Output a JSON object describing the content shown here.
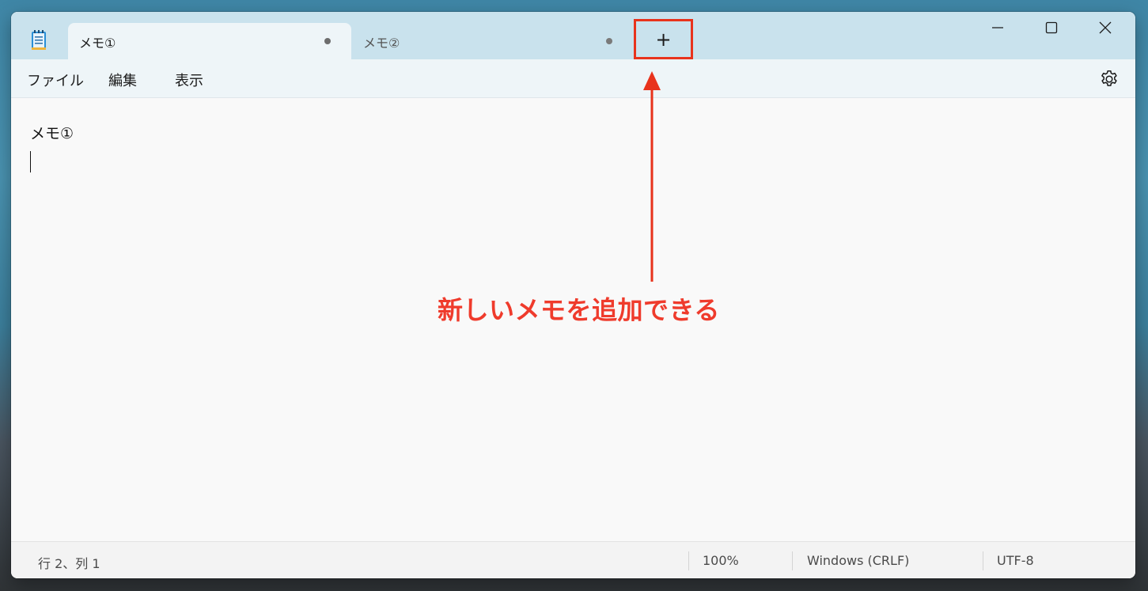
{
  "tabs": [
    {
      "label": "メモ①",
      "active": true
    },
    {
      "label": "メモ②",
      "active": false
    }
  ],
  "new_tab": {
    "label": "+"
  },
  "menu": {
    "items": [
      "ファイル",
      "編集",
      "表示"
    ]
  },
  "editor": {
    "lines": [
      "メモ①",
      ""
    ]
  },
  "annotation": {
    "text": "新しいメモを追加できる",
    "color": "#ef3b2c"
  },
  "status": {
    "position": "行 2、列 1",
    "zoom": "100%",
    "line_ending": "Windows (CRLF)",
    "encoding": "UTF-8"
  },
  "colors": {
    "titlebar": "#c9e2ed",
    "highlight_box": "#e8331c"
  }
}
